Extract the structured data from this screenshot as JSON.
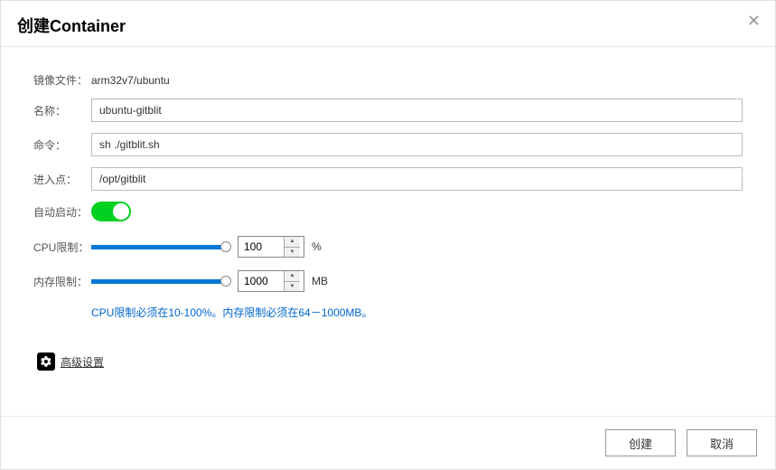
{
  "dialog": {
    "title": "创建Container"
  },
  "form": {
    "image_file_label": "镜像文件：",
    "image_file_value": "arm32v7/ubuntu",
    "name_label": "名称：",
    "name_value": "ubuntu-gitblit",
    "command_label": "命令：",
    "command_value": "sh ./gitblit.sh",
    "entrypoint_label": "进入点：",
    "entrypoint_value": "/opt/gitblit",
    "autostart_label": "自动启动：",
    "autostart_on": true,
    "cpu_label": "CPU限制：",
    "cpu_value": "100",
    "cpu_unit": "%",
    "mem_label": "内存限制：",
    "mem_value": "1000",
    "mem_unit": "MB",
    "hint": "CPU限制必须在10-100%。内存限制必须在64－1000MB。",
    "advanced_label": "高级设置"
  },
  "footer": {
    "create": "创建",
    "cancel": "取消"
  }
}
